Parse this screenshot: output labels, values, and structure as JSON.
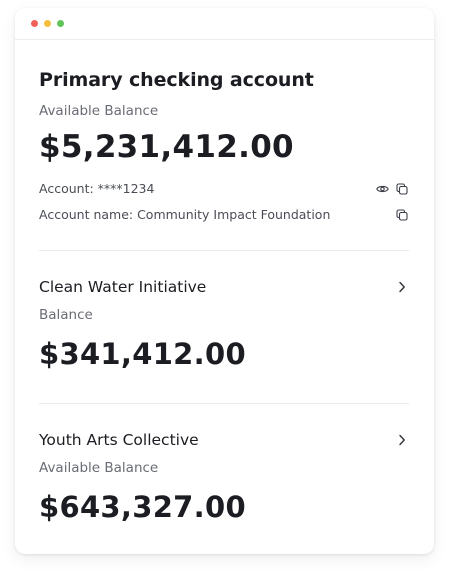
{
  "primary": {
    "title": "Primary checking account",
    "balance_label": "Available Balance",
    "balance": "$5,231,412.00",
    "account_number": "Account: ****1234",
    "account_name": "Account name: Community Impact Foundation"
  },
  "accounts": [
    {
      "name": "Clean Water Initiative",
      "balance_label": "Balance",
      "balance": "$341,412.00"
    },
    {
      "name": "Youth Arts Collective",
      "balance_label": "Available Balance",
      "balance": "$643,327.00"
    }
  ],
  "icons": {
    "reveal": "eye-icon",
    "copy": "copy-icon",
    "navigate": "chevron-right-icon"
  },
  "colors": {
    "text": "#1b1d22",
    "muted": "#6a6d74",
    "window_red": "#f2605a",
    "window_yellow": "#f5be3b",
    "window_green": "#5fc35a"
  }
}
